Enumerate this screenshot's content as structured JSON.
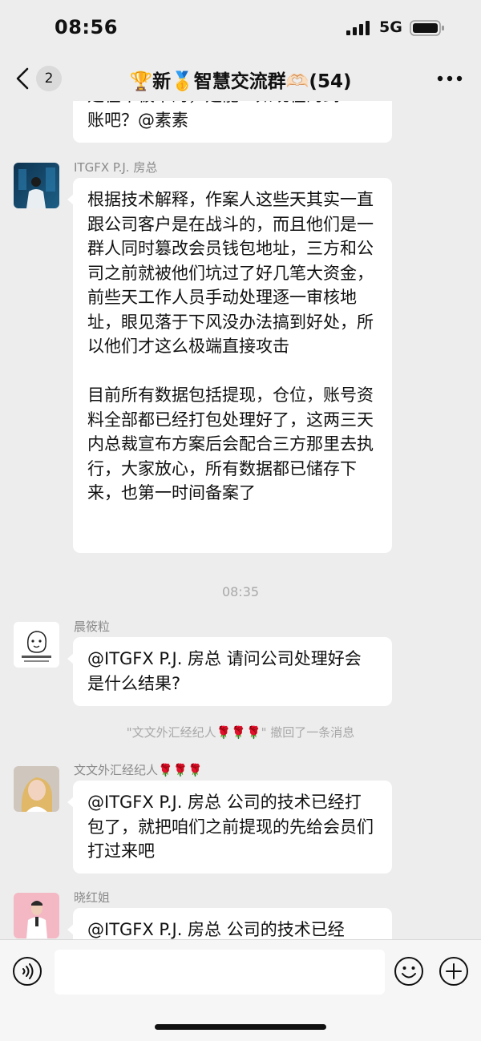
{
  "status_bar": {
    "time": "08:56",
    "network": "5G"
  },
  "nav": {
    "unread_count": "2",
    "title": "🏆新🥇智慧交流群🫶🏻(54)"
  },
  "messages": [
    {
      "type": "text_partial",
      "text": "是在木被卡的，是能一如现在的到\n账吧？@素素"
    },
    {
      "type": "text",
      "sender": "ITGFX P.J. 房总",
      "text": "根据技术解释，作案人这些天其实一直跟公司客户是在战斗的，而且他们是一群人同时篡改会员钱包地址，三方和公司之前就被他们坑过了好几笔大资金，前些天工作人员手动处理逐一审核地址，眼见落于下风没办法搞到好处，所以他们才这么极端直接攻击\n\n目前所有数据包括提现，仓位，账号资料全部都已经打包处理好了，这两三天内总裁宣布方案后会配合三方那里去执行，大家放心，所有数据都已储存下来，也第一时间备案了"
    },
    {
      "type": "timestamp",
      "text": "08:35"
    },
    {
      "type": "text",
      "sender": "晨筱粒",
      "text": "@ITGFX P.J. 房总 请问公司处理好会是什么结果?"
    },
    {
      "type": "recall",
      "text": "\"文文外汇经纪人🌹🌹🌹\" 撤回了一条消息"
    },
    {
      "type": "text",
      "sender": "文文外汇经纪人🌹🌹🌹",
      "text": "@ITGFX P.J. 房总 公司的技术已经打包了，就把咱们之前提现的先给会员们打过来吧"
    },
    {
      "type": "text",
      "sender": "晓红姐",
      "text": "@ITGFX P.J. 房总 公司的技术已经"
    }
  ],
  "input": {
    "placeholder": ""
  },
  "icons": {
    "back": "chevron-left-icon",
    "more": "more-dots-icon",
    "voice": "voice-icon",
    "emoji": "emoji-icon",
    "plus": "plus-icon"
  },
  "colors": {
    "background": "#ededed",
    "bubble": "#ffffff",
    "meta_text": "#a8a8a8"
  }
}
